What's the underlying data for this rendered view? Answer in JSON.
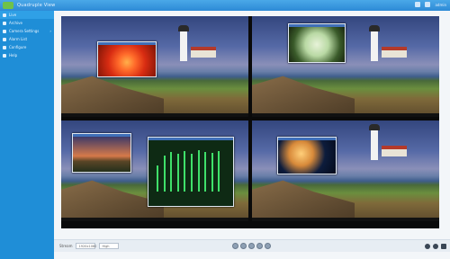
{
  "app": {
    "title": "Quadruple View"
  },
  "topbar": {
    "user": "admin"
  },
  "sidebar": {
    "items": [
      {
        "label": "Live"
      },
      {
        "label": "Archive"
      },
      {
        "label": "Camera Settings"
      },
      {
        "label": "Alarm List"
      },
      {
        "label": "Configure"
      },
      {
        "label": "Help"
      }
    ]
  },
  "video": {
    "cell_labels": [
      "",
      "",
      "",
      ""
    ]
  },
  "footer": {
    "stream_label": "Stream",
    "layout_select": "1920x1080",
    "quality_select": "High"
  }
}
